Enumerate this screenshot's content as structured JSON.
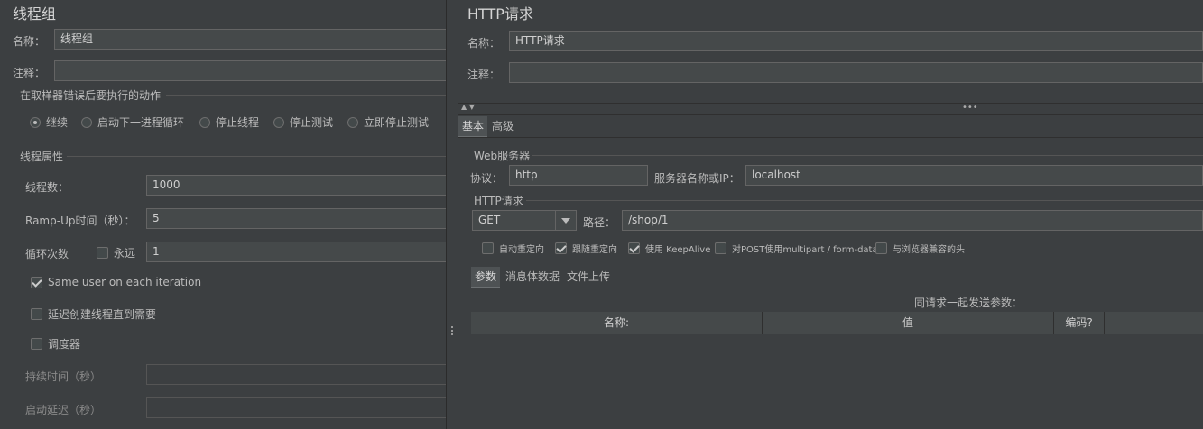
{
  "left": {
    "title": "线程组",
    "name_label": "名称：",
    "name_value": "线程组",
    "comment_label": "注释：",
    "comment_value": "",
    "error_section": "在取样器错误后要执行的动作",
    "error_options": [
      {
        "label": "继续",
        "selected": true
      },
      {
        "label": "启动下一进程循环",
        "selected": false
      },
      {
        "label": "停止线程",
        "selected": false
      },
      {
        "label": "停止测试",
        "selected": false
      },
      {
        "label": "立即停止测试",
        "selected": false
      }
    ],
    "props_section": "线程属性",
    "threads_label": "线程数：",
    "threads_value": "1000",
    "rampup_label": "Ramp-Up时间（秒）：",
    "rampup_value": "5",
    "loop_label": "循环次数",
    "loop_forever_label": "永远",
    "loop_value": "1",
    "same_user_label": "Same user on each iteration",
    "delay_create_label": "延迟创建线程直到需要",
    "scheduler_label": "调度器",
    "duration_label": "持续时间（秒）",
    "startup_delay_label": "启动延迟（秒）"
  },
  "right": {
    "title": "HTTP请求",
    "name_label": "名称：",
    "name_value": "HTTP请求",
    "comment_label": "注释：",
    "comment_value": "",
    "tabs": [
      "基本",
      "高级"
    ],
    "web_server_section": "Web服务器",
    "protocol_label": "协议：",
    "protocol_value": "http",
    "server_label": "服务器名称或IP：",
    "server_value": "localhost",
    "http_section": "HTTP请求",
    "method_value": "GET",
    "path_label": "路径：",
    "path_value": "/shop/1",
    "options": [
      {
        "label": "自动重定向",
        "checked": false
      },
      {
        "label": "跟随重定向",
        "checked": true
      },
      {
        "label": "使用 KeepAlive",
        "checked": true
      },
      {
        "label": "对POST使用multipart / form-data",
        "checked": false
      },
      {
        "label": "与浏览器兼容的头",
        "checked": false
      }
    ],
    "sub_tabs": [
      "参数",
      "消息体数据",
      "文件上传"
    ],
    "params_caption": "同请求一起发送参数：",
    "table_headers": [
      "名称:",
      "值",
      "编码?",
      ""
    ]
  }
}
